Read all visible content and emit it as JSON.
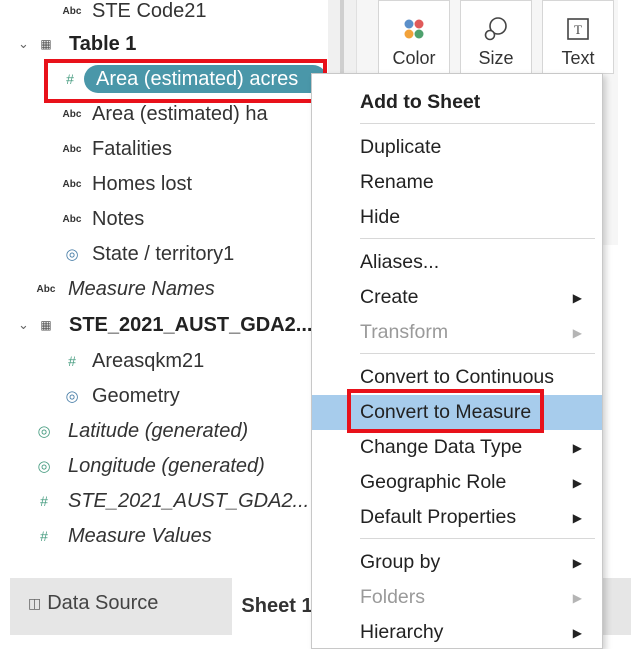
{
  "data_pane": {
    "items": [
      {
        "icon": "abc",
        "label": "STE Code21"
      },
      {
        "icon": "table",
        "label": "Table 1"
      },
      {
        "icon": "hash",
        "label": "Area (estimated) acres"
      },
      {
        "icon": "abc",
        "label": "Area (estimated) ha"
      },
      {
        "icon": "abc",
        "label": "Fatalities"
      },
      {
        "icon": "abc",
        "label": "Homes lost"
      },
      {
        "icon": "abc",
        "label": "Notes"
      },
      {
        "icon": "globe",
        "label": "State / territory1"
      },
      {
        "icon": "abc",
        "label": "Measure Names"
      },
      {
        "icon": "table",
        "label": "STE_2021_AUST_GDA2..."
      },
      {
        "icon": "hash",
        "label": "Areasqkm21"
      },
      {
        "icon": "globe",
        "label": "Geometry"
      },
      {
        "icon": "globe",
        "label": "Latitude (generated)"
      },
      {
        "icon": "globe",
        "label": "Longitude (generated)"
      },
      {
        "icon": "hash",
        "label": "STE_2021_AUST_GDA2..."
      },
      {
        "icon": "hash",
        "label": "Measure Values"
      }
    ],
    "abc_glyph": "Abc"
  },
  "marks": {
    "buttons": [
      {
        "label": "Color",
        "icon": "color-dots-icon"
      },
      {
        "label": "Size",
        "icon": "size-bubbles-icon"
      },
      {
        "label": "Text",
        "icon": "text-box-icon"
      }
    ]
  },
  "tabs": {
    "data_source": "Data Source",
    "sheet": "Sheet 1"
  },
  "context_menu": {
    "items": [
      {
        "label": "Add to Sheet"
      },
      {
        "label": "Duplicate"
      },
      {
        "label": "Rename"
      },
      {
        "label": "Hide"
      },
      {
        "label": "Aliases..."
      },
      {
        "label": "Create"
      },
      {
        "label": "Transform"
      },
      {
        "label": "Convert to Continuous"
      },
      {
        "label": "Convert to Measure"
      },
      {
        "label": "Change Data Type"
      },
      {
        "label": "Geographic Role"
      },
      {
        "label": "Default Properties"
      },
      {
        "label": "Group by"
      },
      {
        "label": "Folders"
      },
      {
        "label": "Hierarchy"
      }
    ]
  },
  "colors": {
    "pill": "#4a97a9",
    "highlight_box": "#e8111a",
    "menu_hover": "#a7ccec",
    "disabled_text": "#9a9a9a"
  }
}
